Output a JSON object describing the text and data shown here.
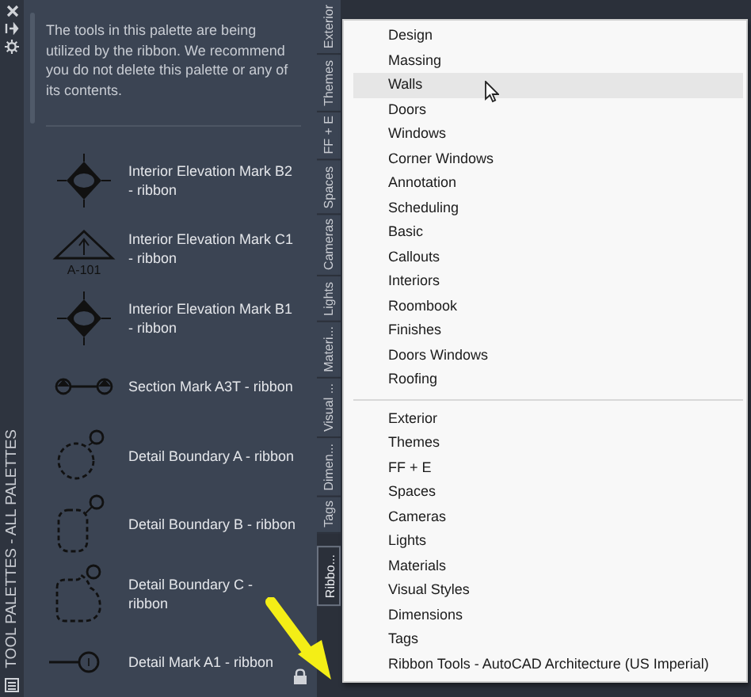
{
  "side_strip": {
    "title": "TOOL PALETTES - ALL PALETTES"
  },
  "palette": {
    "notice": "The tools in this palette are being utilized by the ribbon. We recommend you do not delete this palette or any of its contents.",
    "tools": [
      {
        "kind": "elevation-diamond",
        "label": "Interior Elevation Mark B2 - ribbon"
      },
      {
        "kind": "elevation-triangle",
        "label": "Interior Elevation Mark C1 - ribbon",
        "icon_caption": "A-101"
      },
      {
        "kind": "elevation-diamond",
        "label": "Interior Elevation Mark B1 - ribbon"
      },
      {
        "kind": "section-mark",
        "label": "Section Mark A3T - ribbon"
      },
      {
        "kind": "boundary-circle",
        "label": "Detail Boundary A - ribbon"
      },
      {
        "kind": "boundary-rounded",
        "label": "Detail Boundary B - ribbon"
      },
      {
        "kind": "boundary-cloud",
        "label": "Detail Boundary C - ribbon"
      },
      {
        "kind": "detail-mark",
        "label": "Detail Mark A1 - ribbon"
      }
    ]
  },
  "tabs": [
    {
      "label": "Exterior",
      "selected": false
    },
    {
      "label": "Themes",
      "selected": false
    },
    {
      "label": "FF + E",
      "selected": false
    },
    {
      "label": "Spaces",
      "selected": false
    },
    {
      "label": "Cameras",
      "selected": false
    },
    {
      "label": "Lights",
      "selected": false
    },
    {
      "label": "Materi...",
      "selected": false
    },
    {
      "label": "Visual ...",
      "selected": false
    },
    {
      "label": "Dimen...",
      "selected": false
    },
    {
      "label": "Tags",
      "selected": false
    },
    {
      "label": "Ribbo...",
      "selected": true
    }
  ],
  "menu": {
    "groups": [
      [
        {
          "label": "Design",
          "highlighted": false
        },
        {
          "label": "Massing",
          "highlighted": false
        },
        {
          "label": "Walls",
          "highlighted": true
        },
        {
          "label": "Doors",
          "highlighted": false
        },
        {
          "label": "Windows",
          "highlighted": false
        },
        {
          "label": "Corner Windows",
          "highlighted": false
        },
        {
          "label": "Annotation",
          "highlighted": false
        },
        {
          "label": "Scheduling",
          "highlighted": false
        },
        {
          "label": "Basic",
          "highlighted": false
        },
        {
          "label": "Callouts",
          "highlighted": false
        },
        {
          "label": "Interiors",
          "highlighted": false
        },
        {
          "label": "Roombook",
          "highlighted": false
        },
        {
          "label": "Finishes",
          "highlighted": false
        },
        {
          "label": "Doors  Windows",
          "highlighted": false
        },
        {
          "label": "Roofing",
          "highlighted": false
        }
      ],
      [
        {
          "label": "Exterior",
          "highlighted": false
        },
        {
          "label": "Themes",
          "highlighted": false
        },
        {
          "label": "FF + E",
          "highlighted": false
        },
        {
          "label": "Spaces",
          "highlighted": false
        },
        {
          "label": "Cameras",
          "highlighted": false
        },
        {
          "label": "Lights",
          "highlighted": false
        },
        {
          "label": "Materials",
          "highlighted": false
        },
        {
          "label": "Visual Styles",
          "highlighted": false
        },
        {
          "label": "Dimensions",
          "highlighted": false
        },
        {
          "label": "Tags",
          "highlighted": false
        },
        {
          "label": "Ribbon Tools - AutoCAD Architecture (US Imperial)",
          "highlighted": false
        }
      ]
    ]
  }
}
